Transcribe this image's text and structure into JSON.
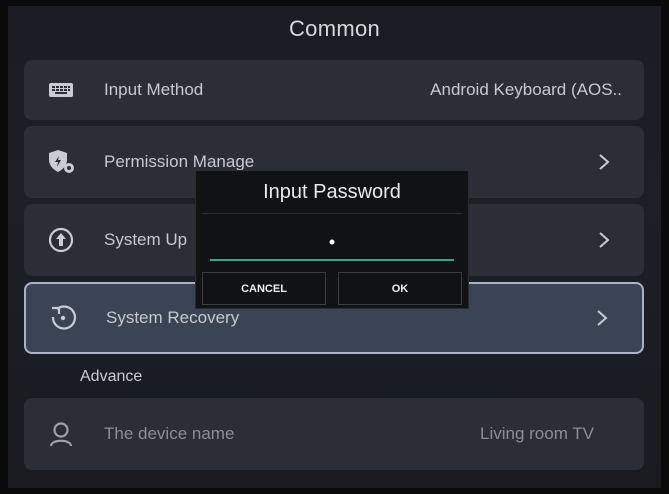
{
  "header": {
    "title": "Common"
  },
  "items": [
    {
      "icon": "keyboard-icon",
      "label": "Input Method",
      "value": "Android Keyboard (AOS.."
    },
    {
      "icon": "shield-gear-icon",
      "label": "Permission Manage"
    },
    {
      "icon": "upgrade-icon",
      "label": "System Up"
    },
    {
      "icon": "recovery-icon",
      "label": "System Recovery",
      "selected": true
    }
  ],
  "section": {
    "title": "Advance"
  },
  "advance_items": [
    {
      "icon": "person-icon",
      "label": "The device name",
      "value": "Living room TV"
    }
  ],
  "dialog": {
    "title": "Input Password",
    "password_value": "•",
    "cancel_label": "CANCEL",
    "ok_label": "OK"
  },
  "colors": {
    "accent_line": "#2fa88e",
    "row_bg": "#2a2e37",
    "selected_bg": "#3b4455"
  }
}
